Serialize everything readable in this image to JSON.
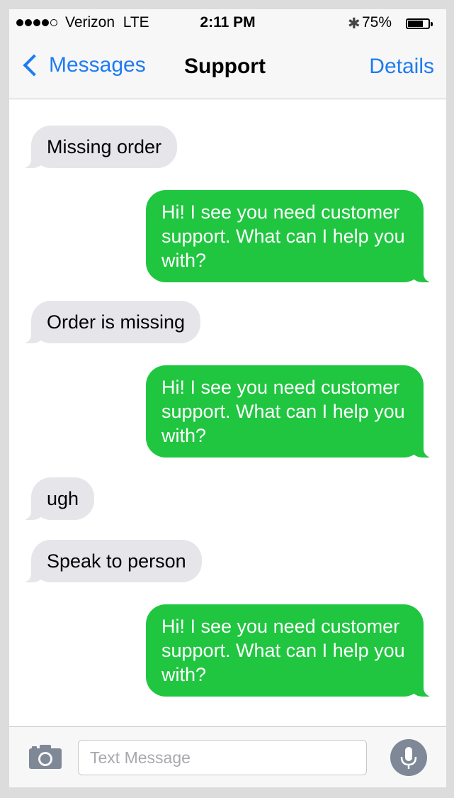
{
  "status_bar": {
    "carrier": "Verizon",
    "network": "LTE",
    "time": "2:11 PM",
    "battery_percent": "75%",
    "battery_level": 0.75,
    "signal_bars_filled": 4,
    "signal_bars_total": 5,
    "icons": [
      "signal-dots-icon",
      "bluetooth-icon",
      "battery-icon"
    ]
  },
  "nav": {
    "back_label": "Messages",
    "title": "Support",
    "details_label": "Details",
    "accent_color": "#1e7cf2"
  },
  "messages": [
    {
      "direction": "incoming",
      "text": "Missing order"
    },
    {
      "direction": "outgoing",
      "text": "Hi! I see you need customer support. What can I help you with?"
    },
    {
      "direction": "incoming",
      "text": "Order is missing"
    },
    {
      "direction": "outgoing",
      "text": "Hi! I see you need customer support. What can I help you with?"
    },
    {
      "direction": "incoming",
      "text": "ugh"
    },
    {
      "direction": "incoming",
      "text": "Speak to person"
    },
    {
      "direction": "outgoing",
      "text": "Hi! I see you need customer support. What can I help you with?"
    }
  ],
  "colors": {
    "incoming_bubble": "#e5e5ea",
    "outgoing_bubble": "#20c640"
  },
  "input_bar": {
    "placeholder": "Text Message",
    "value": "",
    "camera_icon": "camera-icon",
    "mic_icon": "microphone-icon"
  }
}
